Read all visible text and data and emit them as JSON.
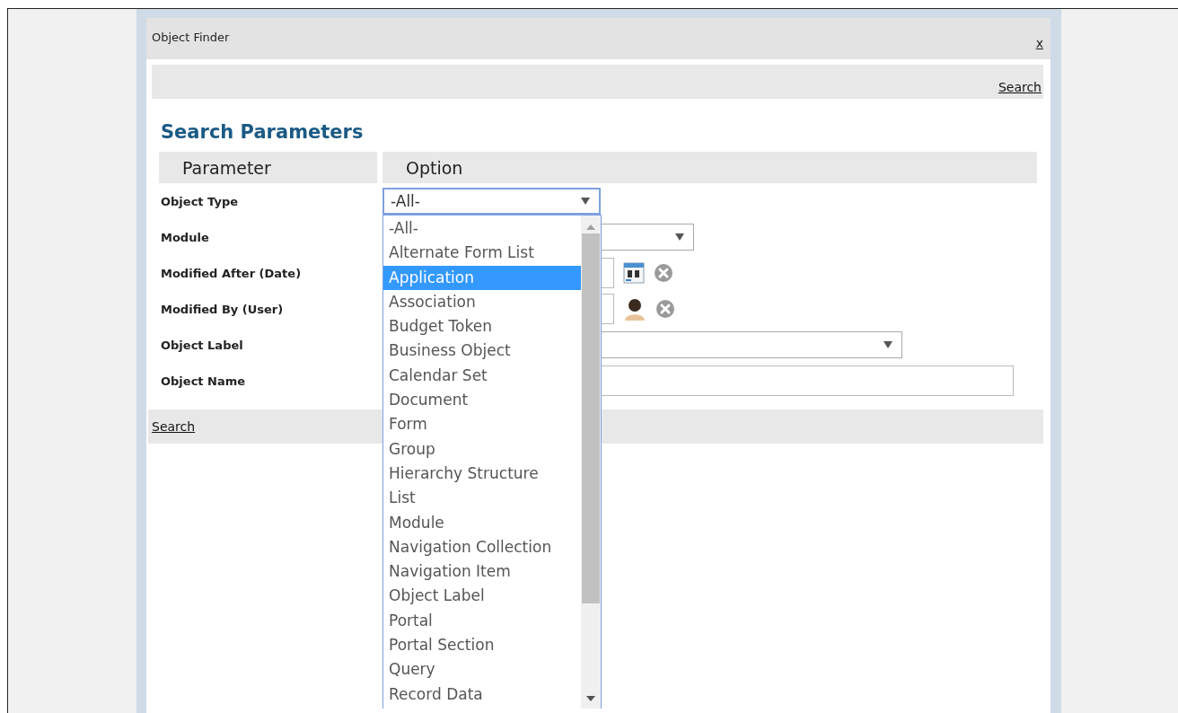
{
  "window": {
    "title": "Object Finder",
    "close": "x"
  },
  "toolbar": {
    "link": "Search"
  },
  "heading": "Search Parameters",
  "table": {
    "columns": [
      "Parameter",
      "Option"
    ],
    "rows": [
      {
        "label": "Object Type",
        "kind": "select",
        "value": "-All-",
        "open": true
      },
      {
        "label": "Module",
        "kind": "select"
      },
      {
        "label": "Modified After (Date)",
        "kind": "date"
      },
      {
        "label": "Modified By (User)",
        "kind": "user"
      },
      {
        "label": "Object Label",
        "kind": "wide-select"
      },
      {
        "label": "Object Name",
        "kind": "text"
      }
    ]
  },
  "dropdown": {
    "options": [
      {
        "label": "-All-",
        "selected": false
      },
      {
        "label": "Alternate Form List",
        "selected": false
      },
      {
        "label": "Application",
        "selected": true
      },
      {
        "label": "Association",
        "selected": false
      },
      {
        "label": "Budget Token",
        "selected": false
      },
      {
        "label": "Business Object",
        "selected": false
      },
      {
        "label": "Calendar Set",
        "selected": false
      },
      {
        "label": "Document",
        "selected": false
      },
      {
        "label": "Form",
        "selected": false
      },
      {
        "label": "Group",
        "selected": false
      },
      {
        "label": "Hierarchy Structure",
        "selected": false
      },
      {
        "label": "List",
        "selected": false
      },
      {
        "label": "Module",
        "selected": false
      },
      {
        "label": "Navigation Collection",
        "selected": false
      },
      {
        "label": "Navigation Item",
        "selected": false
      },
      {
        "label": "Object Label",
        "selected": false
      },
      {
        "label": "Portal",
        "selected": false
      },
      {
        "label": "Portal Section",
        "selected": false
      },
      {
        "label": "Query",
        "selected": false
      },
      {
        "label": "Record Data",
        "selected": false
      }
    ]
  },
  "footer": {
    "link": "Search"
  }
}
